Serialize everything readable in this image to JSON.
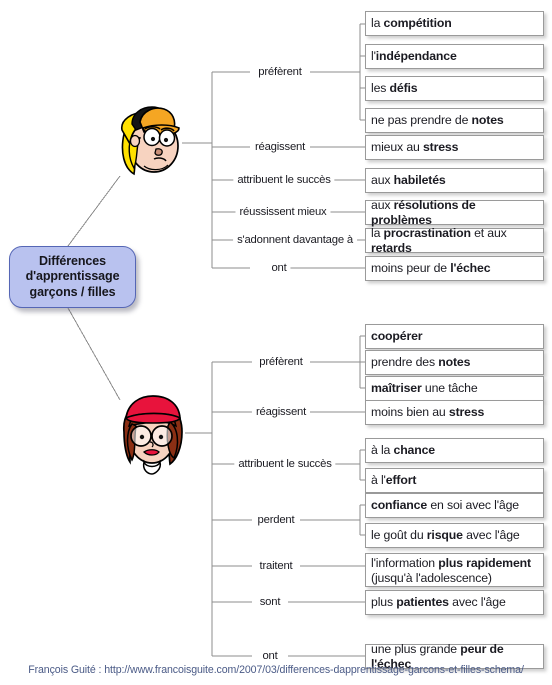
{
  "diagram": {
    "title": "Différences d'apprentissage garçons / filles",
    "root": {
      "label": "Différences\nd'apprentissage\ngarçons / filles",
      "fill_color": "#b9c2ef",
      "border_color": "#5566b5"
    },
    "branches": [
      {
        "id": "garcons",
        "avatar_name": "boy-avatar",
        "avatar_description": "cartoon boy with blonde hair and orange cap",
        "groups": [
          {
            "label": "préfèrent",
            "leaves": [
              {
                "plain_before": "la ",
                "bold": "compétition",
                "plain_after": ""
              },
              {
                "plain_before": "l'",
                "bold": "indépendance",
                "plain_after": ""
              },
              {
                "plain_before": "les ",
                "bold": "défis",
                "plain_after": ""
              },
              {
                "plain_before": "ne pas prendre de ",
                "bold": "notes",
                "plain_after": ""
              }
            ]
          },
          {
            "label": "réagissent",
            "leaves": [
              {
                "plain_before": "mieux au ",
                "bold": "stress",
                "plain_after": ""
              }
            ]
          },
          {
            "label": "attribuent le succès",
            "leaves": [
              {
                "plain_before": "aux ",
                "bold": "habiletés",
                "plain_after": ""
              }
            ]
          },
          {
            "label": "réussissent mieux",
            "leaves": [
              {
                "plain_before": "aux ",
                "bold": "résolutions de problèmes",
                "plain_after": ""
              }
            ]
          },
          {
            "label": "s'adonnent davantage à",
            "leaves": [
              {
                "plain_before": "la ",
                "bold": "procrastination",
                "plain_after": " et aux ",
                "bold2": "retards"
              }
            ]
          },
          {
            "label": "ont",
            "leaves": [
              {
                "plain_before": "moins peur de ",
                "bold": "l'échec",
                "plain_after": ""
              }
            ]
          }
        ]
      },
      {
        "id": "filles",
        "avatar_name": "girl-avatar",
        "avatar_description": "cartoon girl with auburn hair, red beanie and round glasses",
        "groups": [
          {
            "label": "préfèrent",
            "leaves": [
              {
                "plain_before": "",
                "bold": "coopérer",
                "plain_after": ""
              },
              {
                "plain_before": "prendre des ",
                "bold": "notes",
                "plain_after": ""
              },
              {
                "plain_before": "",
                "bold": "maîtriser",
                "plain_after": " une tâche"
              }
            ]
          },
          {
            "label": "réagissent",
            "leaves": [
              {
                "plain_before": "moins bien au ",
                "bold": "stress",
                "plain_after": ""
              }
            ]
          },
          {
            "label": "attribuent le succès",
            "leaves": [
              {
                "plain_before": "à la ",
                "bold": "chance",
                "plain_after": ""
              },
              {
                "plain_before": "à l'",
                "bold": "effort",
                "plain_after": ""
              }
            ]
          },
          {
            "label": "perdent",
            "leaves": [
              {
                "plain_before": "",
                "bold": "confiance",
                "plain_after": " en soi avec l'âge"
              },
              {
                "plain_before": "le goût du ",
                "bold": "risque",
                "plain_after": " avec l'âge"
              }
            ]
          },
          {
            "label": "traitent",
            "leaves": [
              {
                "plain_before": "l'information ",
                "bold": "plus rapidement",
                "plain_after": "\n(jusqu'à l'adolescence)"
              }
            ]
          },
          {
            "label": "sont",
            "leaves": [
              {
                "plain_before": "plus ",
                "bold": "patientes",
                "plain_after": " avec l'âge"
              }
            ]
          },
          {
            "label": "ont",
            "leaves": [
              {
                "plain_before": "une plus grande ",
                "bold": "peur de l'échec",
                "plain_after": ""
              }
            ]
          }
        ]
      }
    ],
    "footer": {
      "credit": "François Guité : http://www.francoisguite.com/2007/03/differences-dapprentissage-garcons-et-filles-schema/",
      "color": "#4a5a86"
    },
    "line_color": "#8d8d8d"
  }
}
